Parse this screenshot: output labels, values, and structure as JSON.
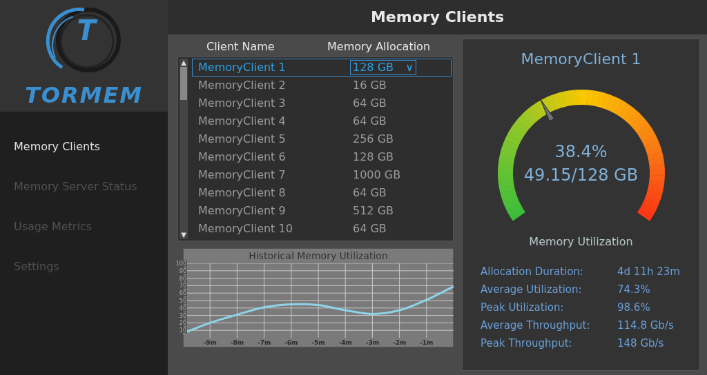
{
  "logo": {
    "text": "TORMEM",
    "letter": "T"
  },
  "header": {
    "title": "Memory Clients"
  },
  "sidebar": {
    "items": [
      {
        "label": "Memory Clients",
        "selected": true
      },
      {
        "label": "Memory Server Status",
        "selected": false
      },
      {
        "label": "Usage Metrics",
        "selected": false
      },
      {
        "label": "Settings",
        "selected": false
      }
    ]
  },
  "table": {
    "columns": [
      "Client Name",
      "Memory Allocation"
    ],
    "rows": [
      {
        "name": "MemoryClient 1",
        "allocation": "128 GB",
        "selected": true
      },
      {
        "name": "MemoryClient 2",
        "allocation": "16 GB",
        "selected": false
      },
      {
        "name": "MemoryClient 3",
        "allocation": "64 GB",
        "selected": false
      },
      {
        "name": "MemoryClient 4",
        "allocation": "64 GB",
        "selected": false
      },
      {
        "name": "MemoryClient 5",
        "allocation": "256 GB",
        "selected": false
      },
      {
        "name": "MemoryClient 6",
        "allocation": "128 GB",
        "selected": false
      },
      {
        "name": "MemoryClient 7",
        "allocation": "1000 GB",
        "selected": false
      },
      {
        "name": "MemoryClient 8",
        "allocation": "64 GB",
        "selected": false
      },
      {
        "name": "MemoryClient 9",
        "allocation": "512 GB",
        "selected": false
      },
      {
        "name": "MemoryClient 10",
        "allocation": "64 GB",
        "selected": false
      }
    ],
    "dropdown_glyph": "∨",
    "scroll_up": "▲",
    "scroll_down": "▼"
  },
  "history": {
    "chart_data": {
      "type": "line",
      "title": "Historical Memory Utilization",
      "x": [
        -10,
        -9,
        -8,
        -7,
        -6,
        -5,
        -4,
        -3,
        -2,
        -1,
        0
      ],
      "grid": true,
      "series": [
        {
          "color": "#8fd3e8",
          "values": [
            6,
            20,
            31,
            41,
            45,
            44,
            37,
            32,
            37,
            51,
            69
          ]
        }
      ],
      "xlim": [
        -10,
        0
      ],
      "ylim": [
        0,
        100
      ],
      "xticks": [
        {
          "value": -9,
          "label": "-9m"
        },
        {
          "value": -8,
          "label": "-8m"
        },
        {
          "value": -7,
          "label": "-7m"
        },
        {
          "value": -6,
          "label": "-6m"
        },
        {
          "value": -5,
          "label": "-5m"
        },
        {
          "value": -4,
          "label": "-4m"
        },
        {
          "value": -3,
          "label": "-3m"
        },
        {
          "value": -2,
          "label": "-2m"
        },
        {
          "value": -1,
          "label": "-1m"
        }
      ],
      "yticks": [
        10,
        20,
        30,
        40,
        50,
        60,
        70,
        80,
        90,
        100
      ]
    }
  },
  "detail": {
    "title": "MemoryClient 1",
    "gauge": {
      "percent": "38.4%",
      "amount": "49.15/128 GB",
      "caption": "Memory Utilization"
    },
    "stats": [
      {
        "label": "Allocation Duration:",
        "value": "4d 11h 23m"
      },
      {
        "label": "Average Utilization:",
        "value": "74.3%"
      },
      {
        "label": "Peak Utilization:",
        "value": "98.6%"
      },
      {
        "label": "Average Throughput:",
        "value": "114.8 Gb/s"
      },
      {
        "label": "Peak Throughput:",
        "value": "148 Gb/s"
      }
    ]
  }
}
